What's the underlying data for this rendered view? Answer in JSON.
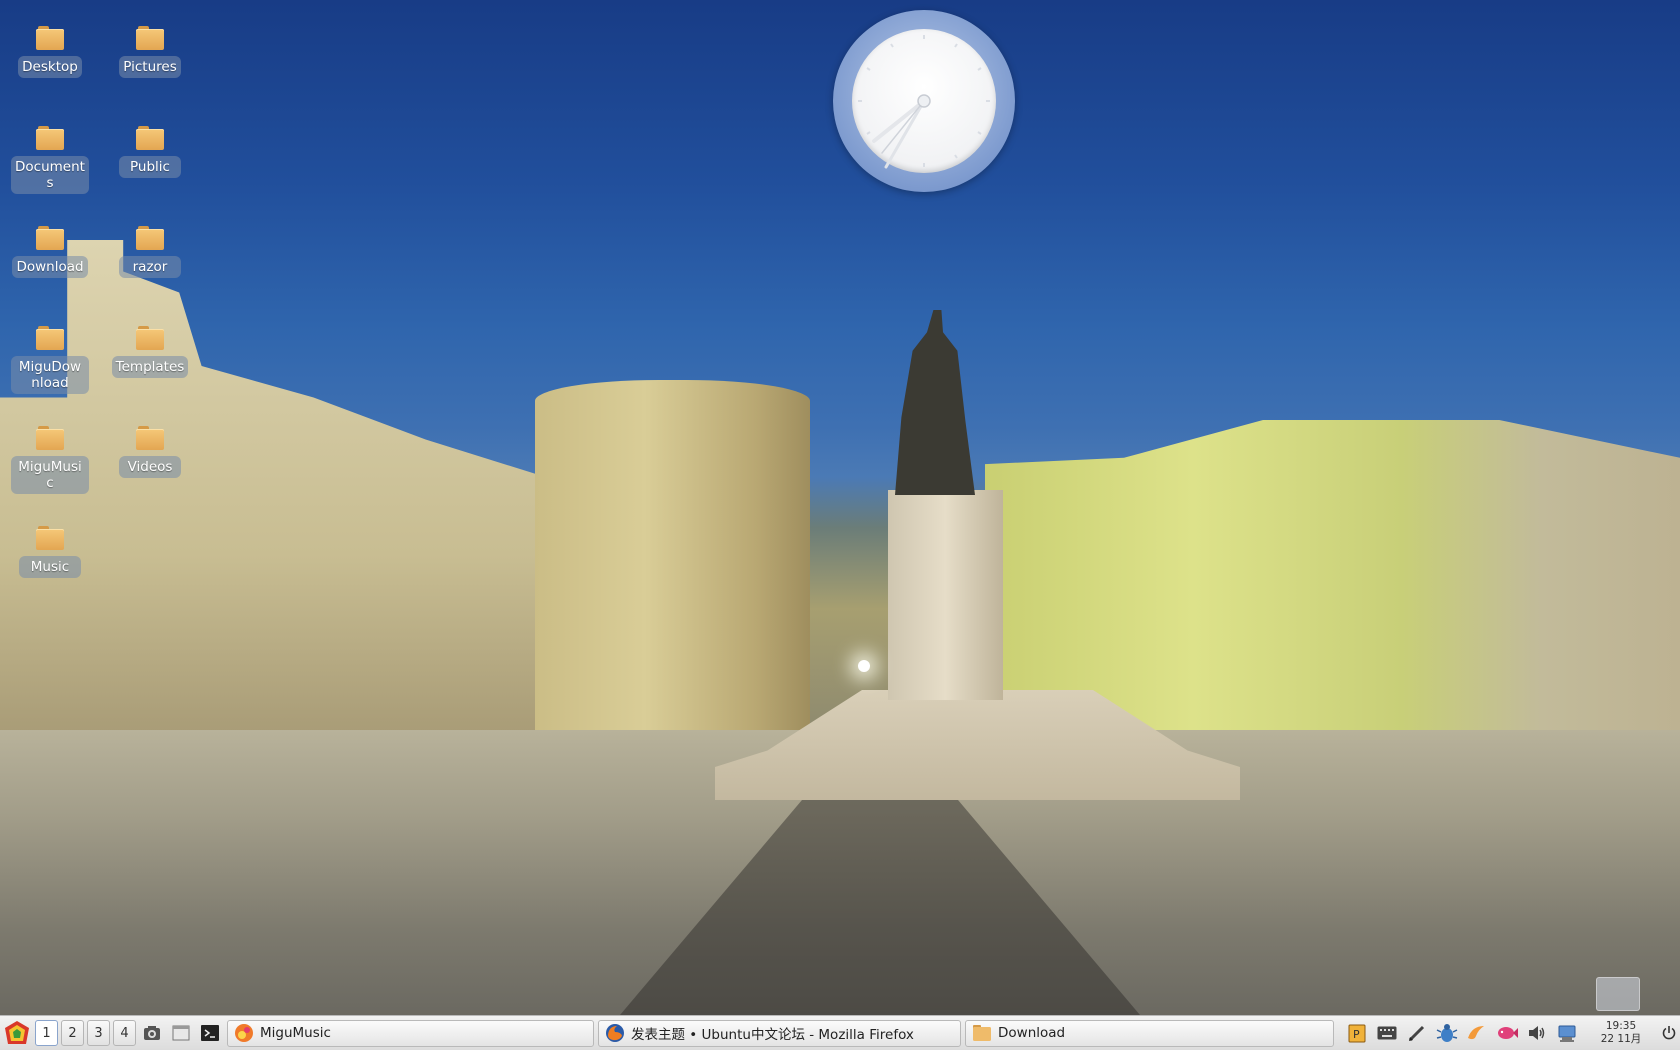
{
  "desktop_icons": [
    {
      "label": "Desktop"
    },
    {
      "label": "Documents"
    },
    {
      "label": "Download"
    },
    {
      "label": "MiguDownload"
    },
    {
      "label": "MiguMusic"
    },
    {
      "label": "Music"
    },
    {
      "label": "Pictures"
    },
    {
      "label": "Public"
    },
    {
      "label": "razor"
    },
    {
      "label": "Templates"
    },
    {
      "label": "Videos"
    }
  ],
  "clock_widget": {
    "time": "19:35"
  },
  "taskbar": {
    "desktops": [
      "1",
      "2",
      "3",
      "4"
    ],
    "active_desktop": "1",
    "tasks": [
      {
        "title": "MiguMusic",
        "icon": "migumusic-icon"
      },
      {
        "title": "发表主题 • Ubuntu中文论坛 - Mozilla Firefox",
        "icon": "firefox-icon"
      },
      {
        "title": "Download",
        "icon": "folder-icon"
      }
    ],
    "tray_icons": [
      "clipboard-icon",
      "keyboard-icon",
      "pen-icon",
      "bug-icon",
      "shrimp-icon",
      "fish-icon",
      "volume-icon",
      "network-icon"
    ],
    "time": "19:35",
    "date": "22 11月"
  },
  "colors": {
    "folder": "#e8ad5a",
    "label_bg": "#7f92ad",
    "taskbar_bg": "#e6e6e6"
  }
}
